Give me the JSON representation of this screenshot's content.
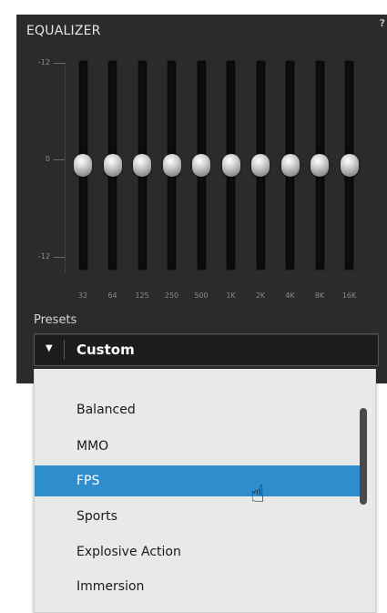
{
  "equalizer": {
    "title": "EQUALIZER",
    "help": "?",
    "scale": {
      "top": "-12",
      "mid": "0",
      "bottom": "-12"
    },
    "bands": [
      "32",
      "64",
      "125",
      "250",
      "500",
      "1K",
      "2K",
      "4K",
      "8K",
      "16K"
    ],
    "levels_db": [
      0,
      0,
      0,
      0,
      0,
      0,
      0,
      0,
      0,
      0
    ]
  },
  "presets": {
    "label": "Presets",
    "selected": "Custom",
    "arrow_icon": "triangle-down-icon",
    "options": [
      "Balanced",
      "MMO",
      "FPS",
      "Sports",
      "Explosive Action",
      "Immersion"
    ],
    "highlighted": "FPS"
  },
  "colors": {
    "panel": "#2b2b2b",
    "highlight": "#2e8ecd",
    "dropdown": "#e9e9e9"
  }
}
